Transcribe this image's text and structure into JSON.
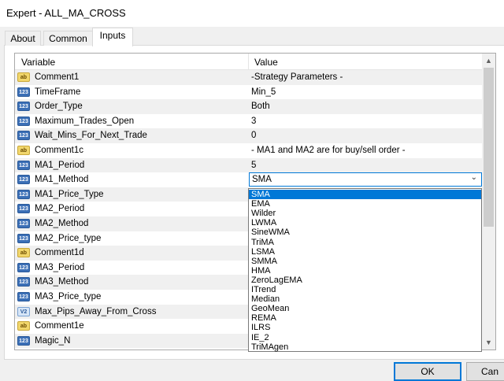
{
  "window": {
    "title": "Expert - ALL_MA_CROSS"
  },
  "tabs": [
    {
      "label": "About"
    },
    {
      "label": "Common"
    },
    {
      "label": "Inputs"
    }
  ],
  "grid": {
    "columns": {
      "variable": "Variable",
      "value": "Value"
    },
    "rows": [
      {
        "name": "Comment1",
        "value": "-Strategy Parameters -",
        "icon": "string-icon"
      },
      {
        "name": "TimeFrame",
        "value": "Min_5",
        "icon": "int-icon"
      },
      {
        "name": "Order_Type",
        "value": "Both",
        "icon": "int-icon"
      },
      {
        "name": "Maximum_Trades_Open",
        "value": "3",
        "icon": "int-icon"
      },
      {
        "name": "Wait_Mins_For_Next_Trade",
        "value": "0",
        "icon": "int-icon"
      },
      {
        "name": "Comment1c",
        "value": "- MA1 and MA2 are for buy/sell order -",
        "icon": "string-icon"
      },
      {
        "name": "MA1_Period",
        "value": "5",
        "icon": "int-icon"
      },
      {
        "name": "MA1_Method",
        "value": "SMA",
        "icon": "int-icon"
      },
      {
        "name": "MA1_Price_Type",
        "value": "",
        "icon": "int-icon"
      },
      {
        "name": "MA2_Period",
        "value": "",
        "icon": "int-icon"
      },
      {
        "name": "MA2_Method",
        "value": "",
        "icon": "int-icon"
      },
      {
        "name": "MA2_Price_type",
        "value": "",
        "icon": "int-icon"
      },
      {
        "name": "Comment1d",
        "value": "",
        "icon": "string-icon"
      },
      {
        "name": "MA3_Period",
        "value": "",
        "icon": "int-icon"
      },
      {
        "name": "MA3_Method",
        "value": "",
        "icon": "int-icon"
      },
      {
        "name": "MA3_Price_type",
        "value": "",
        "icon": "int-icon"
      },
      {
        "name": "Max_Pips_Away_From_Cross",
        "value": "",
        "icon": "double-icon"
      },
      {
        "name": "Comment1e",
        "value": "",
        "icon": "string-icon"
      },
      {
        "name": "Magic_N",
        "value": "",
        "icon": "int-icon"
      }
    ]
  },
  "icon_labels": {
    "string-icon": "ab",
    "int-icon": "123",
    "double-icon": "V2"
  },
  "dropdown": {
    "selected": "SMA",
    "options": [
      "SMA",
      "EMA",
      "Wilder",
      "LWMA",
      "SineWMA",
      "TriMA",
      "LSMA",
      "SMMA",
      "HMA",
      "ZeroLagEMA",
      "ITrend",
      "Median",
      "GeoMean",
      "REMA",
      "ILRS",
      "IE_2",
      "TriMAgen"
    ]
  },
  "buttons": {
    "ok": "OK",
    "cancel": "Can"
  },
  "colors": {
    "accent": "#0078d7",
    "alt_row": "#f0f0f0"
  }
}
